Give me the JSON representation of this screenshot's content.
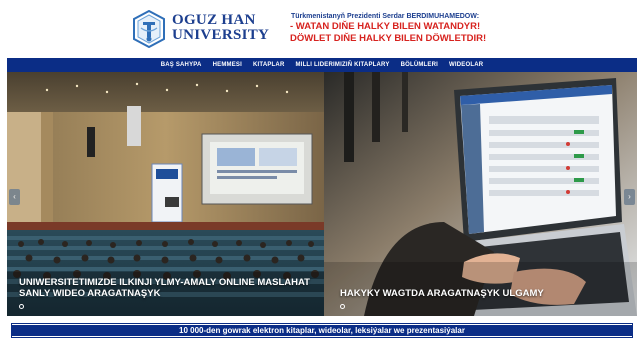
{
  "header": {
    "logo_line1": "OGUZ HAN",
    "logo_line2": "UNIVERSITY",
    "slogan_top": "Türkmenistanyň Prezidenti Serdar BERDIMUHAMEDOW:",
    "slogan_line1": "- WATAN DIŇE HALKY BILEN WATANDYR!",
    "slogan_line2": "DÖWLET DIŇE HALKY BILEN DÖWLETDIR!"
  },
  "nav": {
    "items": [
      {
        "label": "BAŞ SAHYPA"
      },
      {
        "label": "HEMMESI"
      },
      {
        "label": "KITAPLAR"
      },
      {
        "label": "MILLI LIDERIMIZIŇ KITAPLARY"
      },
      {
        "label": "BÖLÜMLERI"
      },
      {
        "label": "WIDEOLAR"
      }
    ]
  },
  "slides": {
    "left": {
      "caption_line1": "UNIWERSITETIMIZDE ILKINJI YLMY-AMALY ONLINE MASLAHAT",
      "caption_line2": "SANLY WIDEO ARAGATNAŞYK"
    },
    "right": {
      "caption": "HAKYKY WAGTDA ARAGATNAŞYK ULGAMY"
    },
    "prev_glyph": "‹",
    "next_glyph": "›"
  },
  "bottom_bar": {
    "text": "10 000-den gowrak elektron kitaplar, wideolar, leksiýalar we prezentasiýalar"
  },
  "colors": {
    "brand_blue": "#0b2d86",
    "slogan_red": "#d7231f",
    "logo_blue": "#1d3f8f"
  },
  "icons": {
    "logo": "university-emblem-icon",
    "prev": "chevron-left-icon",
    "next": "chevron-right-icon"
  }
}
